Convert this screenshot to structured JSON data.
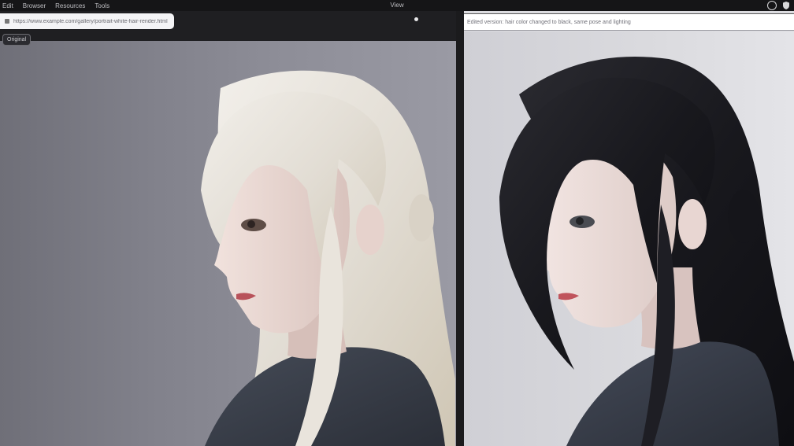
{
  "topbar": {
    "menu": [
      "Edit",
      "Browser",
      "Resources",
      "Tools"
    ],
    "title": "View"
  },
  "left_panel": {
    "address": "https://www.example.com/gallery/portrait-white-hair-render.html",
    "badge": "Original"
  },
  "right_panel": {
    "address": "Edited version: hair color changed to black, same pose and lighting"
  },
  "colors": {
    "accent": "#1b1b1d",
    "left_background": "#82828c",
    "right_background": "#dadade",
    "white_hair": "#e6e2dc",
    "black_hair": "#1c1c22",
    "sweater": "#3a3f4a"
  }
}
